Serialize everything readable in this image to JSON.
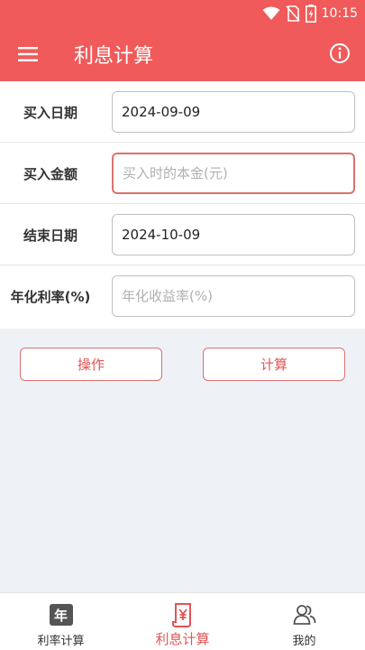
{
  "status_bar": {
    "time": "10:15",
    "icons": [
      "wifi-icon",
      "no-sim-icon",
      "battery-charging-icon"
    ]
  },
  "app_bar": {
    "title": "利息计算",
    "menu_icon": "hamburger-menu-icon",
    "info_icon": "info-icon"
  },
  "form": {
    "rows": [
      {
        "label": "买入日期",
        "value": "2024-09-09",
        "placeholder": ""
      },
      {
        "label": "买入金额",
        "value": "",
        "placeholder": "买入时的本金(元)"
      },
      {
        "label": "结束日期",
        "value": "2024-10-09",
        "placeholder": ""
      },
      {
        "label": "年化利率(%)",
        "value": "",
        "placeholder": "年化收益率(%)"
      }
    ]
  },
  "actions": {
    "operate_label": "操作",
    "calculate_label": "计算"
  },
  "tabbar": {
    "tabs": [
      {
        "label": "利率计算",
        "icon": "year-calendar-icon",
        "badge": "年",
        "active": false
      },
      {
        "label": "利息计算",
        "icon": "yen-scroll-icon",
        "active": true
      },
      {
        "label": "我的",
        "icon": "user-group-icon",
        "active": false
      }
    ]
  },
  "colors": {
    "primary": "#f05a5a",
    "accent_text": "#e05555",
    "button_border": "#d9726f",
    "background": "#eef2f7"
  }
}
